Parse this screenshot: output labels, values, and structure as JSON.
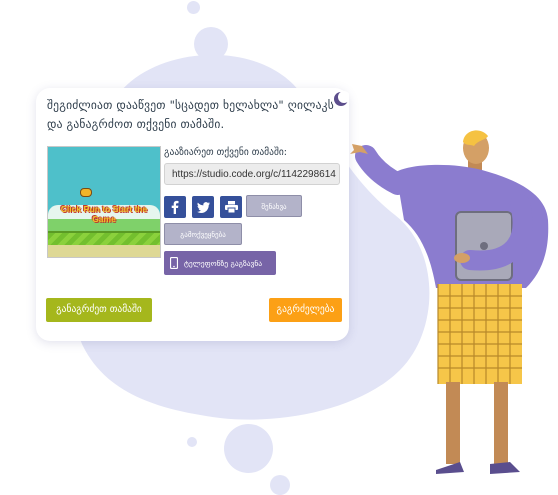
{
  "dialog": {
    "title": "შეგიძლიათ დააწვეთ \"სცადეთ ხელახლა\" ღილაკს და განაგრძოთ თქვენი თამაში.",
    "game_thumbnail_text": "Click Run to Start the Game",
    "share_label": "გააზიარეთ თქვენი თამაში:",
    "share_url": "https://studio.code.org/c/1142298614",
    "share_icons": [
      "facebook-icon",
      "twitter-icon",
      "printer-icon"
    ],
    "save_label": "შენახვა",
    "publish_label": "გამოქვეყნება",
    "send_to_phone_label": "ტელეფონზე გაგზავნა",
    "continue_label": "განაგრძეთ თამაში",
    "next_label": "გაგრძელება"
  },
  "colors": {
    "blob": "#e2e4f6",
    "share_icon_bg": "#35509a",
    "continue_button": "#a5b71c",
    "next_button": "#fca015",
    "phone_button": "#7764a7"
  }
}
